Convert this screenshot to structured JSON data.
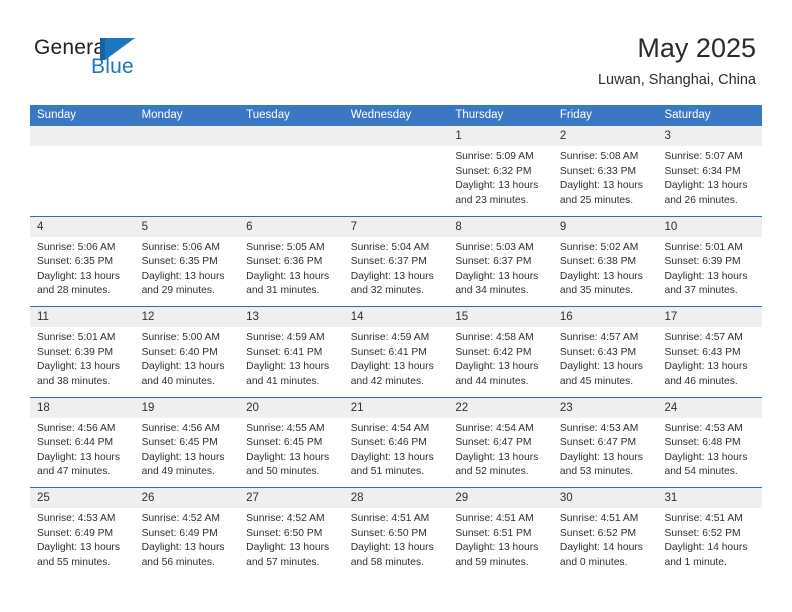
{
  "brand": {
    "name_part1": "General",
    "name_part2": "Blue",
    "mark": "triangle-flag-logo"
  },
  "header": {
    "title": "May 2025",
    "subtitle": "Luwan, Shanghai, China"
  },
  "calendar": {
    "weekdays": [
      "Sunday",
      "Monday",
      "Tuesday",
      "Wednesday",
      "Thursday",
      "Friday",
      "Saturday"
    ],
    "colors": {
      "header_blue": "#3b78c3",
      "row_divider_blue": "#2f6cb5",
      "day_band_gray": "#efefef",
      "brand_blue": "#1d76bf"
    },
    "weeks": [
      [
        {
          "day": "",
          "lines": []
        },
        {
          "day": "",
          "lines": []
        },
        {
          "day": "",
          "lines": []
        },
        {
          "day": "",
          "lines": []
        },
        {
          "day": "1",
          "lines": [
            "Sunrise: 5:09 AM",
            "Sunset: 6:32 PM",
            "Daylight: 13 hours",
            "and 23 minutes."
          ]
        },
        {
          "day": "2",
          "lines": [
            "Sunrise: 5:08 AM",
            "Sunset: 6:33 PM",
            "Daylight: 13 hours",
            "and 25 minutes."
          ]
        },
        {
          "day": "3",
          "lines": [
            "Sunrise: 5:07 AM",
            "Sunset: 6:34 PM",
            "Daylight: 13 hours",
            "and 26 minutes."
          ]
        }
      ],
      [
        {
          "day": "4",
          "lines": [
            "Sunrise: 5:06 AM",
            "Sunset: 6:35 PM",
            "Daylight: 13 hours",
            "and 28 minutes."
          ]
        },
        {
          "day": "5",
          "lines": [
            "Sunrise: 5:06 AM",
            "Sunset: 6:35 PM",
            "Daylight: 13 hours",
            "and 29 minutes."
          ]
        },
        {
          "day": "6",
          "lines": [
            "Sunrise: 5:05 AM",
            "Sunset: 6:36 PM",
            "Daylight: 13 hours",
            "and 31 minutes."
          ]
        },
        {
          "day": "7",
          "lines": [
            "Sunrise: 5:04 AM",
            "Sunset: 6:37 PM",
            "Daylight: 13 hours",
            "and 32 minutes."
          ]
        },
        {
          "day": "8",
          "lines": [
            "Sunrise: 5:03 AM",
            "Sunset: 6:37 PM",
            "Daylight: 13 hours",
            "and 34 minutes."
          ]
        },
        {
          "day": "9",
          "lines": [
            "Sunrise: 5:02 AM",
            "Sunset: 6:38 PM",
            "Daylight: 13 hours",
            "and 35 minutes."
          ]
        },
        {
          "day": "10",
          "lines": [
            "Sunrise: 5:01 AM",
            "Sunset: 6:39 PM",
            "Daylight: 13 hours",
            "and 37 minutes."
          ]
        }
      ],
      [
        {
          "day": "11",
          "lines": [
            "Sunrise: 5:01 AM",
            "Sunset: 6:39 PM",
            "Daylight: 13 hours",
            "and 38 minutes."
          ]
        },
        {
          "day": "12",
          "lines": [
            "Sunrise: 5:00 AM",
            "Sunset: 6:40 PM",
            "Daylight: 13 hours",
            "and 40 minutes."
          ]
        },
        {
          "day": "13",
          "lines": [
            "Sunrise: 4:59 AM",
            "Sunset: 6:41 PM",
            "Daylight: 13 hours",
            "and 41 minutes."
          ]
        },
        {
          "day": "14",
          "lines": [
            "Sunrise: 4:59 AM",
            "Sunset: 6:41 PM",
            "Daylight: 13 hours",
            "and 42 minutes."
          ]
        },
        {
          "day": "15",
          "lines": [
            "Sunrise: 4:58 AM",
            "Sunset: 6:42 PM",
            "Daylight: 13 hours",
            "and 44 minutes."
          ]
        },
        {
          "day": "16",
          "lines": [
            "Sunrise: 4:57 AM",
            "Sunset: 6:43 PM",
            "Daylight: 13 hours",
            "and 45 minutes."
          ]
        },
        {
          "day": "17",
          "lines": [
            "Sunrise: 4:57 AM",
            "Sunset: 6:43 PM",
            "Daylight: 13 hours",
            "and 46 minutes."
          ]
        }
      ],
      [
        {
          "day": "18",
          "lines": [
            "Sunrise: 4:56 AM",
            "Sunset: 6:44 PM",
            "Daylight: 13 hours",
            "and 47 minutes."
          ]
        },
        {
          "day": "19",
          "lines": [
            "Sunrise: 4:56 AM",
            "Sunset: 6:45 PM",
            "Daylight: 13 hours",
            "and 49 minutes."
          ]
        },
        {
          "day": "20",
          "lines": [
            "Sunrise: 4:55 AM",
            "Sunset: 6:45 PM",
            "Daylight: 13 hours",
            "and 50 minutes."
          ]
        },
        {
          "day": "21",
          "lines": [
            "Sunrise: 4:54 AM",
            "Sunset: 6:46 PM",
            "Daylight: 13 hours",
            "and 51 minutes."
          ]
        },
        {
          "day": "22",
          "lines": [
            "Sunrise: 4:54 AM",
            "Sunset: 6:47 PM",
            "Daylight: 13 hours",
            "and 52 minutes."
          ]
        },
        {
          "day": "23",
          "lines": [
            "Sunrise: 4:53 AM",
            "Sunset: 6:47 PM",
            "Daylight: 13 hours",
            "and 53 minutes."
          ]
        },
        {
          "day": "24",
          "lines": [
            "Sunrise: 4:53 AM",
            "Sunset: 6:48 PM",
            "Daylight: 13 hours",
            "and 54 minutes."
          ]
        }
      ],
      [
        {
          "day": "25",
          "lines": [
            "Sunrise: 4:53 AM",
            "Sunset: 6:49 PM",
            "Daylight: 13 hours",
            "and 55 minutes."
          ]
        },
        {
          "day": "26",
          "lines": [
            "Sunrise: 4:52 AM",
            "Sunset: 6:49 PM",
            "Daylight: 13 hours",
            "and 56 minutes."
          ]
        },
        {
          "day": "27",
          "lines": [
            "Sunrise: 4:52 AM",
            "Sunset: 6:50 PM",
            "Daylight: 13 hours",
            "and 57 minutes."
          ]
        },
        {
          "day": "28",
          "lines": [
            "Sunrise: 4:51 AM",
            "Sunset: 6:50 PM",
            "Daylight: 13 hours",
            "and 58 minutes."
          ]
        },
        {
          "day": "29",
          "lines": [
            "Sunrise: 4:51 AM",
            "Sunset: 6:51 PM",
            "Daylight: 13 hours",
            "and 59 minutes."
          ]
        },
        {
          "day": "30",
          "lines": [
            "Sunrise: 4:51 AM",
            "Sunset: 6:52 PM",
            "Daylight: 14 hours",
            "and 0 minutes."
          ]
        },
        {
          "day": "31",
          "lines": [
            "Sunrise: 4:51 AM",
            "Sunset: 6:52 PM",
            "Daylight: 14 hours",
            "and 1 minute."
          ]
        }
      ]
    ]
  }
}
